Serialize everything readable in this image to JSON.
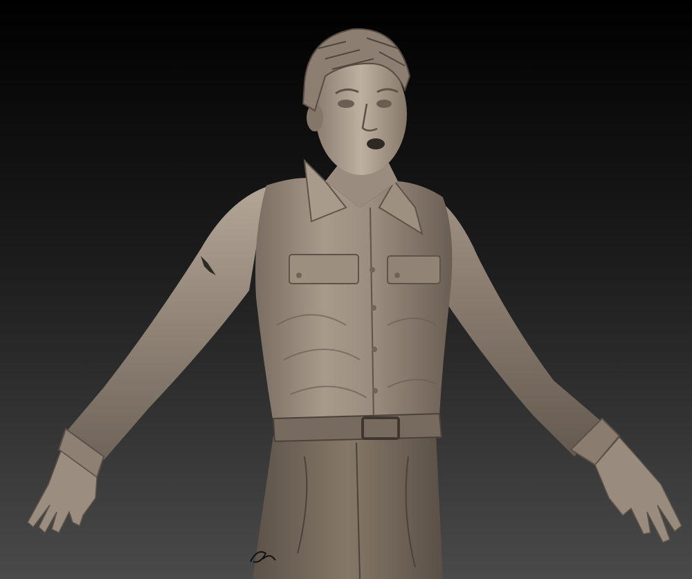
{
  "scene": {
    "subject": "sculpt-render",
    "palette": {
      "background_top": "#000000",
      "background_bottom": "#4a4a4a",
      "clay_light": "#bfb2a3",
      "clay_mid": "#8e8174",
      "clay_dark": "#4f463d",
      "shadow": "#2a241f"
    }
  }
}
